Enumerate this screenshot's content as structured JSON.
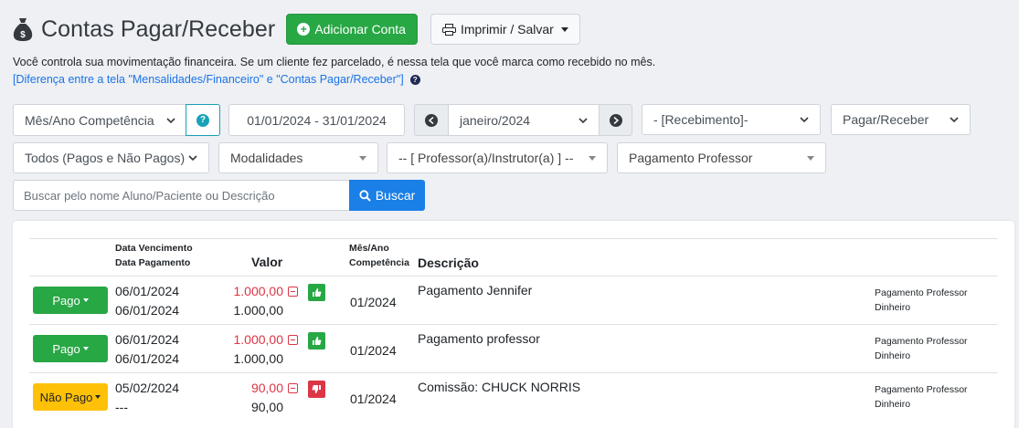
{
  "header": {
    "title": "Contas Pagar/Receber",
    "add_button": "Adicionar Conta",
    "print_button": "Imprimir / Salvar"
  },
  "info": {
    "description": "Você controla sua movimentação financeira. Se um cliente fez parcelado, é nessa tela que você marca como recebido no mês.",
    "link": "[Diferença entre a tela \"Mensalidades/Financeiro\" e \"Contas Pagar/Receber\"]"
  },
  "filters": {
    "period_type": "Mês/Ano Competência",
    "date_range": "01/01/2024 - 31/01/2024",
    "month": "janeiro/2024",
    "receipt": "- [Recebimento]-",
    "direction": "Pagar/Receber",
    "paid_status": "Todos (Pagos e Não Pagos)",
    "modalities": "Modalidades",
    "professor": "-- [ Professor(a)/Instrutor(a) ] --",
    "category": "Pagamento Professor"
  },
  "search": {
    "placeholder": "Buscar pelo nome Aluno/Paciente ou Descrição",
    "button": "Buscar"
  },
  "table": {
    "headers": {
      "dates_line1": "Data Vencimento",
      "dates_line2": "Data Pagamento",
      "value": "Valor",
      "comp_line1": "Mês/Ano",
      "comp_line2": "Competência",
      "description": "Descrição"
    },
    "rows": [
      {
        "status": "Pago",
        "due": "06/01/2024",
        "paid": "06/01/2024",
        "value": "1.000,00",
        "paid_value": "1.000,00",
        "competence": "01/2024",
        "description": "Pagamento Jennifer",
        "tag1": "Pagamento Professor",
        "tag2": "Dinheiro"
      },
      {
        "status": "Pago",
        "due": "06/01/2024",
        "paid": "06/01/2024",
        "value": "1.000,00",
        "paid_value": "1.000,00",
        "competence": "01/2024",
        "description": "Pagamento professor",
        "tag1": "Pagamento Professor",
        "tag2": "Dinheiro"
      },
      {
        "status": "Não Pago",
        "due": "05/02/2024",
        "paid": "---",
        "value": "90,00",
        "paid_value": "90,00",
        "competence": "01/2024",
        "description": "Comissão: CHUCK NORRIS",
        "tag1": "Pagamento Professor",
        "tag2": "Dinheiro"
      }
    ]
  },
  "colors": {
    "green": "#28a745",
    "yellow": "#ffc107",
    "red": "#dc3545",
    "blue": "#1a7fe6",
    "info": "#17a2b8"
  }
}
